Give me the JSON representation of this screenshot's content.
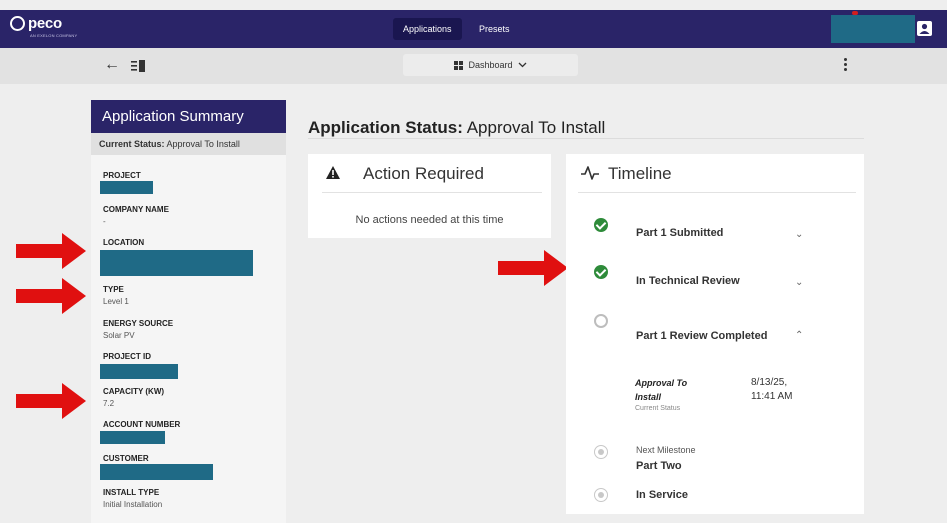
{
  "brand": {
    "name": "peco",
    "tagline": "AN EXELON COMPANY"
  },
  "nav": {
    "tabs": [
      {
        "label": "Applications",
        "active": true
      },
      {
        "label": "Presets",
        "active": false
      }
    ],
    "user_icon": "user-icon"
  },
  "toolbar": {
    "back_icon": "arrow-left-icon",
    "panel_icon": "panel-toggle-icon",
    "dashboard_label": "Dashboard",
    "menu_icon": "kebab-menu-icon"
  },
  "summary": {
    "title": "Application Summary",
    "status_label": "Current Status:",
    "status_value": "Approval To Install",
    "fields": {
      "project": {
        "label": "PROJECT"
      },
      "company": {
        "label": "COMPANY NAME",
        "value": "-"
      },
      "location": {
        "label": "LOCATION"
      },
      "type": {
        "label": "TYPE",
        "value": "Level 1"
      },
      "energy": {
        "label": "ENERGY SOURCE",
        "value": "Solar PV"
      },
      "project_id": {
        "label": "PROJECT ID"
      },
      "capacity": {
        "label": "CAPACITY (KW)",
        "value": "7.2"
      },
      "account": {
        "label": "ACCOUNT NUMBER"
      },
      "customer": {
        "label": "CUSTOMER"
      },
      "install_type": {
        "label": "INSTALL TYPE",
        "value": "Initial Installation"
      }
    }
  },
  "main": {
    "title_bold": "Application Status:",
    "title_rest": " Approval To Install",
    "action": {
      "title": "Action Required",
      "message": "No actions needed at this time",
      "icon": "warning-icon"
    },
    "timeline": {
      "title": "Timeline",
      "icon": "pulse-icon",
      "steps": [
        {
          "label": "Part 1 Submitted",
          "state": "complete"
        },
        {
          "label": "In Technical Review",
          "state": "complete"
        },
        {
          "label": "Part 1 Review Completed",
          "state": "open"
        },
        {
          "label": "Part Two",
          "prefix": "Next Milestone",
          "state": "future"
        },
        {
          "label": "In Service",
          "state": "future"
        }
      ],
      "sub_status": {
        "name": "Approval To Install",
        "date": "8/13/25,",
        "time": "11:41 AM",
        "note": "Current Status"
      }
    }
  },
  "colors": {
    "nav": "#2a2468",
    "redaction": "#1f6a86",
    "success": "#2e8b3a",
    "annotation_arrow": "#e01010"
  }
}
